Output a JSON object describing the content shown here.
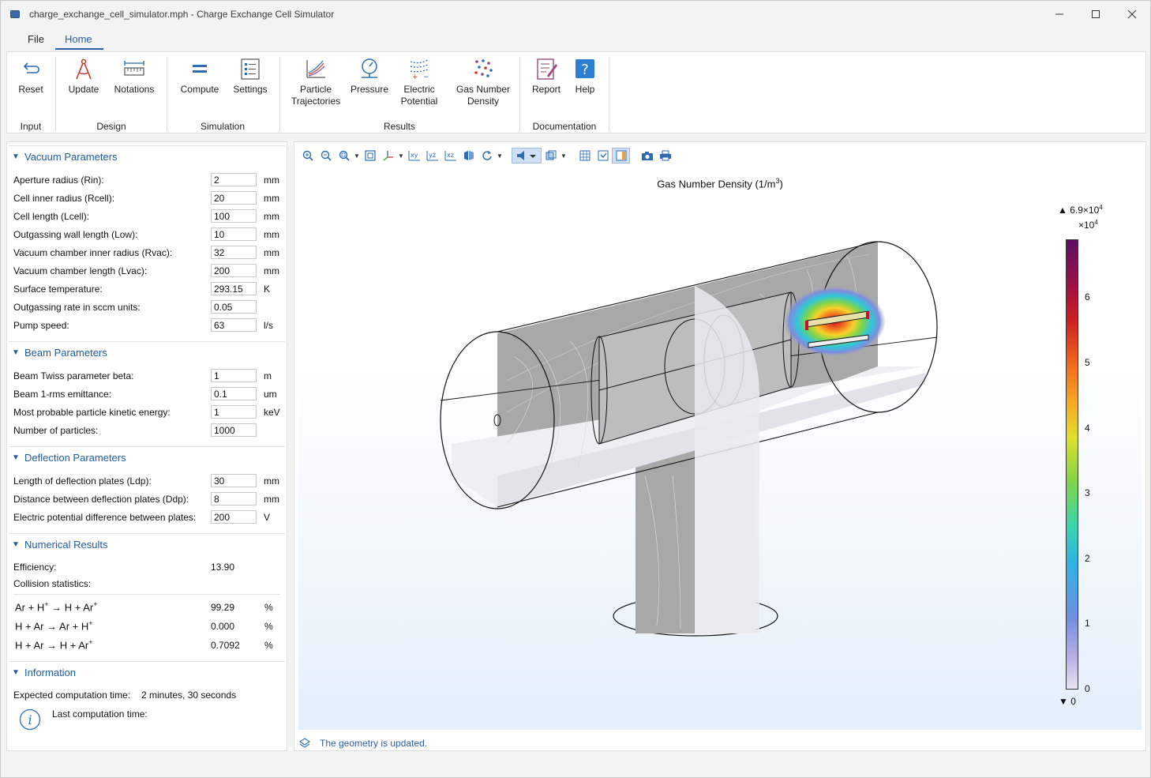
{
  "window": {
    "title": "charge_exchange_cell_simulator.mph - Charge Exchange Cell Simulator",
    "controls": [
      "minimize",
      "maximize",
      "close"
    ]
  },
  "menu": {
    "file": "File",
    "home": "Home"
  },
  "ribbon": {
    "groups": {
      "input": "Input",
      "design": "Design",
      "simulation": "Simulation",
      "results": "Results",
      "documentation": "Documentation"
    },
    "buttons": {
      "reset": "Reset",
      "update": "Update",
      "notations": "Notations",
      "compute": "Compute",
      "settings": "Settings",
      "particle_line1": "Particle",
      "particle_line2": "Trajectories",
      "pressure": "Pressure",
      "electric_line1": "Electric",
      "electric_line2": "Potential",
      "gas_line1": "Gas Number",
      "gas_line2": "Density",
      "report": "Report",
      "help": "Help"
    }
  },
  "panel": {
    "vacuum": {
      "title": "Vacuum Parameters",
      "rows": [
        {
          "label": "Aperture radius (Rin):",
          "value": "2",
          "unit": "mm"
        },
        {
          "label": "Cell inner radius (Rcell):",
          "value": "20",
          "unit": "mm"
        },
        {
          "label": "Cell length (Lcell):",
          "value": "100",
          "unit": "mm"
        },
        {
          "label": "Outgassing wall length (Low):",
          "value": "10",
          "unit": "mm"
        },
        {
          "label": "Vacuum chamber inner radius (Rvac):",
          "value": "32",
          "unit": "mm"
        },
        {
          "label": "Vacuum chamber length (Lvac):",
          "value": "200",
          "unit": "mm"
        },
        {
          "label": "Surface temperature:",
          "value": "293.15",
          "unit": "K"
        },
        {
          "label": "Outgassing rate in sccm units:",
          "value": "0.05",
          "unit": ""
        },
        {
          "label": "Pump speed:",
          "value": "63",
          "unit": "l/s"
        }
      ]
    },
    "beam": {
      "title": "Beam Parameters",
      "rows": [
        {
          "label": "Beam Twiss parameter beta:",
          "value": "1",
          "unit": "m"
        },
        {
          "label": "Beam 1-rms emittance:",
          "value": "0.1",
          "unit": "um"
        },
        {
          "label": "Most probable particle kinetic energy:",
          "value": "1",
          "unit": "keV"
        },
        {
          "label": "Number of particles:",
          "value": "1000",
          "unit": ""
        }
      ]
    },
    "deflection": {
      "title": "Deflection Parameters",
      "rows": [
        {
          "label": "Length of deflection plates (Ldp):",
          "value": "30",
          "unit": "mm"
        },
        {
          "label": "Distance between deflection plates (Ddp):",
          "value": "8",
          "unit": "mm"
        },
        {
          "label": "Electric potential difference between plates:",
          "value": "200",
          "unit": "V"
        }
      ]
    },
    "numerical": {
      "title": "Numerical Results",
      "efficiency_label": "Efficiency:",
      "efficiency_value": "13.90",
      "collision_label": "Collision statistics:",
      "reactions": [
        {
          "lhs": "Ar + H",
          "lhs_sup": "+",
          "arrow": "→",
          "rhs": "H + Ar",
          "rhs_sup": "+",
          "value": "99.29",
          "unit": "%"
        },
        {
          "lhs": "H + Ar",
          "lhs_sup": "",
          "arrow": "→",
          "rhs": "Ar + H",
          "rhs_sup": "+",
          "value": "0.000",
          "unit": "%"
        },
        {
          "lhs": "H + Ar",
          "lhs_sup": "",
          "arrow": "→",
          "rhs": "H + Ar",
          "rhs_sup": "+",
          "value": "0.7092",
          "unit": "%"
        }
      ]
    },
    "information": {
      "title": "Information",
      "expected_label": "Expected computation time:",
      "expected_value": "2 minutes, 30 seconds",
      "last_label": "Last computation time:"
    }
  },
  "graphics": {
    "plot_title": "Gas Number Density (1/m",
    "plot_title_sup": "3",
    "plot_title_end": ")",
    "colorbar": {
      "max_label": "6.9×10",
      "max_exp": "4",
      "scale_label": "×10",
      "scale_exp": "4",
      "min_label": "0",
      "ticks": [
        "6",
        "5",
        "4",
        "3",
        "2",
        "1",
        "0"
      ]
    },
    "status": "The geometry is updated."
  },
  "colors": {
    "accent": "#2a5ea8",
    "section_title": "#1f5c9e"
  }
}
